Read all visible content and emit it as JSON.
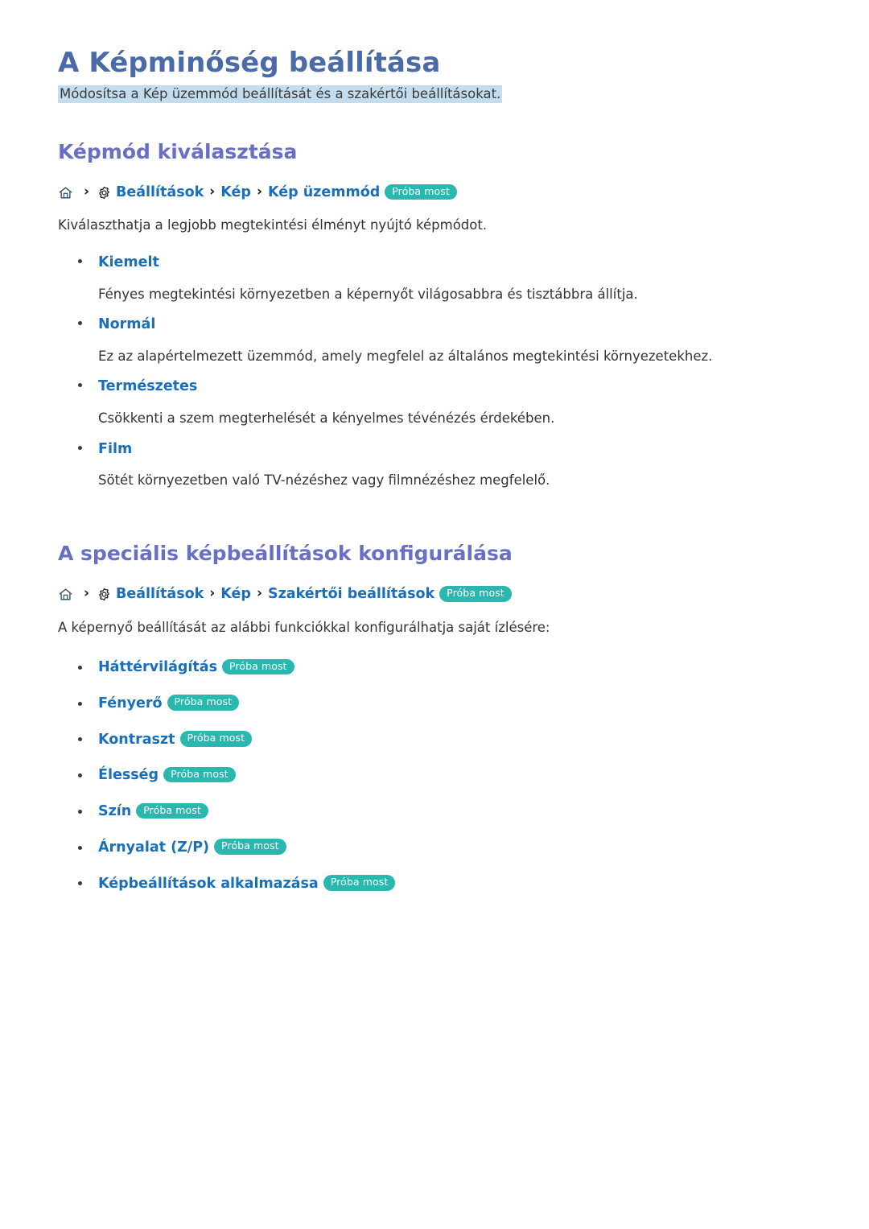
{
  "document": {
    "title": "A Képminőség beállítása",
    "subtitle": "Módosítsa a Kép üzemmód beállítását és a szakértői beállításokat."
  },
  "colors": {
    "title": "#4a6aa8",
    "section_heading": "#6a6fc6",
    "link": "#1a6fba",
    "badge_bg": "#2ab7b0",
    "badge_text": "#ffffff",
    "subtitle_highlight": "#c3dcee",
    "body_text": "#333333",
    "bullet": "#3a3a3a",
    "icon": "#2a4f63"
  },
  "badge_label": "Próba most",
  "sections": [
    {
      "heading": "Képmód kiválasztása",
      "breadcrumb": {
        "home_icon": "home-icon",
        "gear_icon": "gear-icon",
        "separator": "›",
        "items": [
          "Beállítások",
          "Kép",
          "Kép üzemmód"
        ],
        "badge": "Próba most"
      },
      "intro": "Kiválaszthatja a legjobb megtekintési élményt nyújtó képmódot.",
      "modes": [
        {
          "name": "Kiemelt",
          "description": "Fényes megtekintési környezetben a képernyőt világosabbra és tisztábbra állítja."
        },
        {
          "name": "Normál",
          "description": "Ez az alapértelmezett üzemmód, amely megfelel az általános megtekintési környezetekhez."
        },
        {
          "name": "Természetes",
          "description": "Csökkenti a szem megterhelését a kényelmes tévénézés érdekében."
        },
        {
          "name": "Film",
          "description": "Sötét környezetben való TV-nézéshez vagy filmnézéshez megfelelő."
        }
      ]
    },
    {
      "heading": "A speciális képbeállítások konfigurálása",
      "breadcrumb": {
        "home_icon": "home-icon",
        "gear_icon": "gear-icon",
        "separator": "›",
        "items": [
          "Beállítások",
          "Kép",
          "Szakértői beállítások"
        ],
        "badge": "Próba most"
      },
      "intro": "A képernyő beállítását az alábbi funkciókkal konfigurálhatja saját ízlésére:",
      "features": [
        {
          "name": "Háttérvilágítás",
          "badge": "Próba most"
        },
        {
          "name": "Fényerő",
          "badge": "Próba most"
        },
        {
          "name": "Kontraszt",
          "badge": "Próba most"
        },
        {
          "name": "Élesség",
          "badge": "Próba most"
        },
        {
          "name": "Szín",
          "badge": "Próba most"
        },
        {
          "name": "Árnyalat (Z/P)",
          "badge": "Próba most"
        },
        {
          "name": "Képbeállítások alkalmazása",
          "badge": "Próba most"
        }
      ]
    }
  ]
}
